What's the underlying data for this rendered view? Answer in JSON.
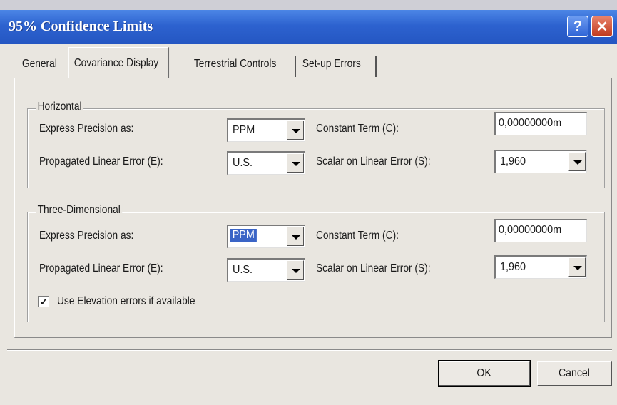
{
  "dialog": {
    "title": "95% Confidence Limits"
  },
  "tabs": [
    {
      "label": "General",
      "active": false
    },
    {
      "label": "Covariance Display",
      "active": true
    },
    {
      "label": "Terrestrial Controls",
      "active": false
    },
    {
      "label": "Set-up Errors",
      "active": false
    }
  ],
  "horizontal": {
    "title": "Horizontal",
    "express_precision_label": "Express Precision as:",
    "express_precision_value": "PPM",
    "propagated_error_label": "Propagated Linear Error (E):",
    "propagated_error_value": "U.S.",
    "constant_term_label": "Constant Term (C):",
    "constant_term_value": "0,00000000m",
    "scalar_label": "Scalar on Linear Error (S):",
    "scalar_value": "1,960"
  },
  "three_dimensional": {
    "title": "Three-Dimensional",
    "express_precision_label": "Express Precision as:",
    "express_precision_value": "PPM",
    "propagated_error_label": "Propagated Linear Error (E):",
    "propagated_error_value": "U.S.",
    "constant_term_label": "Constant Term (C):",
    "constant_term_value": "0,00000000m",
    "scalar_label": "Scalar on Linear Error (S):",
    "scalar_value": "1,960",
    "elevation_checkbox_label": "Use Elevation errors if available",
    "elevation_checked": true,
    "checkmark": "✓"
  },
  "buttons": {
    "ok": "OK",
    "cancel": "Cancel"
  },
  "icons": {
    "help": "?",
    "close": "✕"
  },
  "colors": {
    "titlebar": "#2d62cf",
    "selection": "#3a64c6",
    "dialog_bg": "#e9e6e0"
  }
}
